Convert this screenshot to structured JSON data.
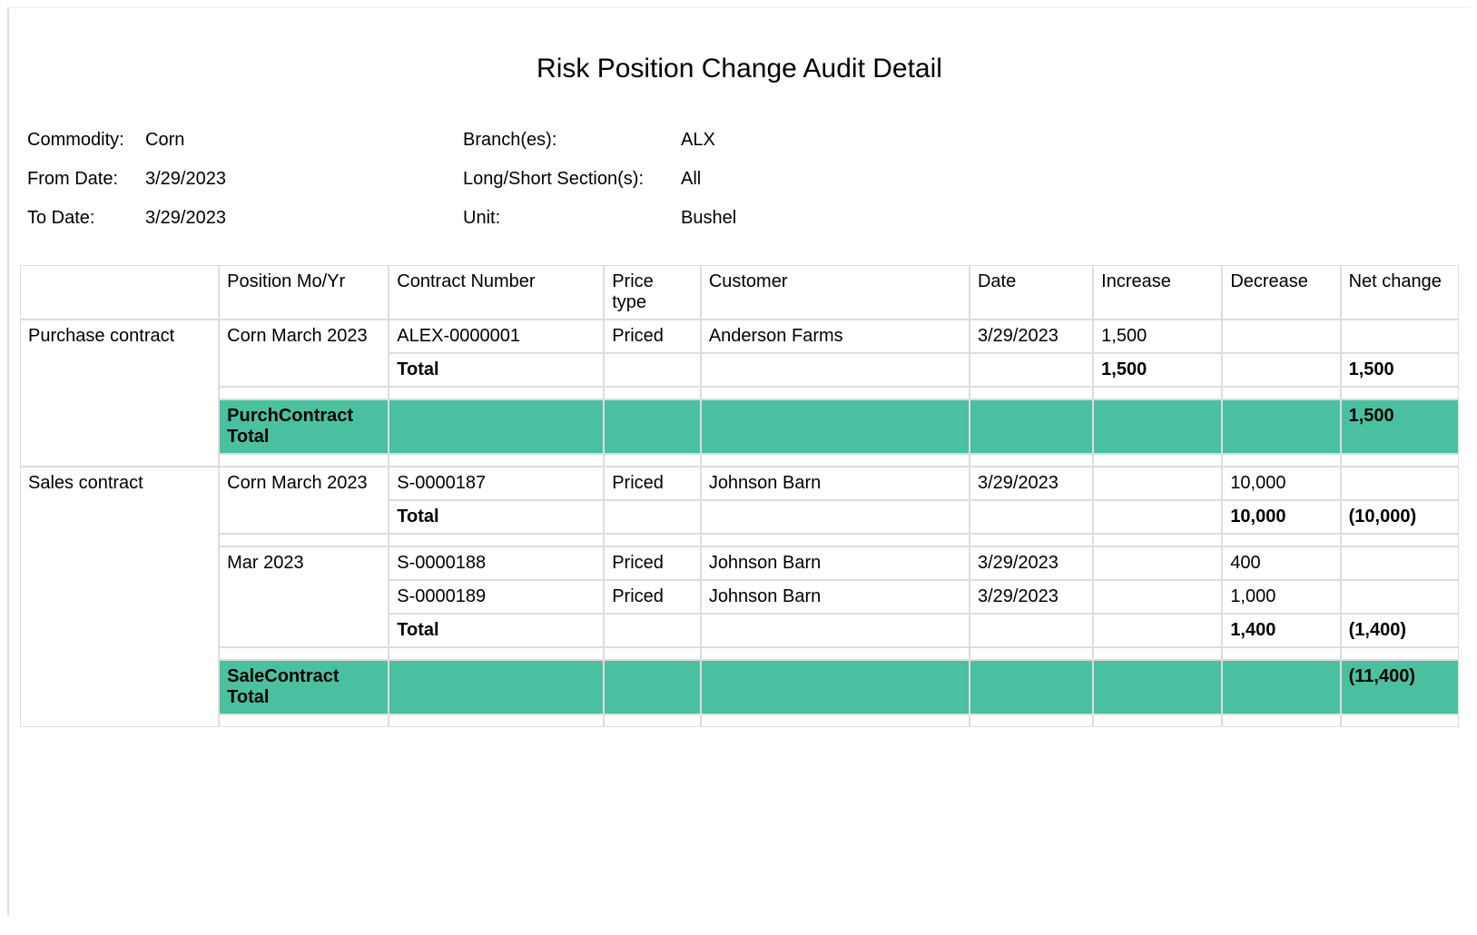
{
  "title": "Risk Position Change Audit Detail",
  "header": {
    "commodity_label": "Commodity:",
    "commodity_value": "Corn",
    "branches_label": "Branch(es):",
    "branches_value": "ALX",
    "from_date_label": "From Date:",
    "from_date_value": "3/29/2023",
    "long_short_label": "Long/Short Section(s):",
    "long_short_value": "All",
    "to_date_label": "To Date:",
    "to_date_value": "3/29/2023",
    "unit_label": "Unit:",
    "unit_value": "Bushel"
  },
  "columns": {
    "category": "",
    "position": "Position Mo/Yr",
    "contract": "Contract Number",
    "price_type": "Price type",
    "customer": "Customer",
    "date": "Date",
    "increase": "Increase",
    "decrease": "Decrease",
    "net_change": "Net change"
  },
  "sections": [
    {
      "category": "Purchase contract",
      "groups": [
        {
          "position": "Corn March 2023",
          "rows": [
            {
              "contract": "ALEX-0000001",
              "price_type": "Priced",
              "customer": "Anderson Farms",
              "date": "3/29/2023",
              "increase": "1,500",
              "decrease": "",
              "net_change": ""
            }
          ],
          "subtotal_label": "Total",
          "subtotal": {
            "increase": "1,500",
            "decrease": "",
            "net_change": "1,500"
          }
        }
      ],
      "section_total_label": "PurchContract Total",
      "section_total": {
        "increase": "",
        "decrease": "",
        "net_change": "1,500"
      }
    },
    {
      "category": "Sales contract",
      "groups": [
        {
          "position": "Corn March 2023",
          "rows": [
            {
              "contract": "S-0000187",
              "price_type": "Priced",
              "customer": "Johnson Barn",
              "date": "3/29/2023",
              "increase": "",
              "decrease": "10,000",
              "net_change": ""
            }
          ],
          "subtotal_label": "Total",
          "subtotal": {
            "increase": "",
            "decrease": "10,000",
            "net_change": "(10,000)"
          }
        },
        {
          "position": "Mar 2023",
          "rows": [
            {
              "contract": "S-0000188",
              "price_type": "Priced",
              "customer": "Johnson Barn",
              "date": "3/29/2023",
              "increase": "",
              "decrease": "400",
              "net_change": ""
            },
            {
              "contract": "S-0000189",
              "price_type": "Priced",
              "customer": "Johnson Barn",
              "date": "3/29/2023",
              "increase": "",
              "decrease": "1,000",
              "net_change": ""
            }
          ],
          "subtotal_label": "Total",
          "subtotal": {
            "increase": "",
            "decrease": "1,400",
            "net_change": "(1,400)"
          }
        }
      ],
      "section_total_label": "SaleContract Total",
      "section_total": {
        "increase": "",
        "decrease": "",
        "net_change": "(11,400)"
      }
    }
  ]
}
